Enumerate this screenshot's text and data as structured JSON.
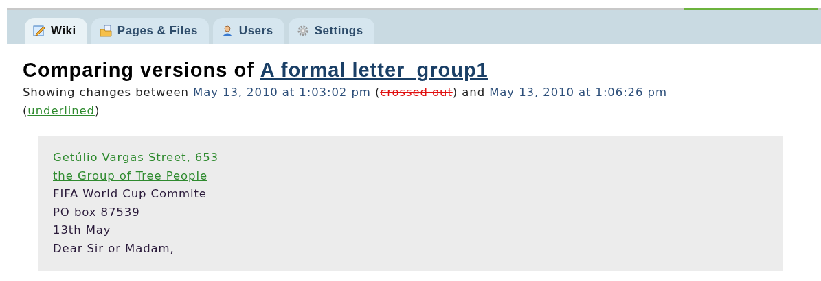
{
  "tabs": [
    {
      "label": "Wiki",
      "kind": "edit",
      "selected": true
    },
    {
      "label": "Pages & Files",
      "kind": "folder",
      "selected": false
    },
    {
      "label": "Users",
      "kind": "user",
      "selected": false
    },
    {
      "label": "Settings",
      "kind": "gear",
      "selected": false
    }
  ],
  "heading": {
    "prefix": "Comparing versions of",
    "link": "A formal letter_group1"
  },
  "summary": [
    {
      "kind": "text",
      "text": "Showing changes between "
    },
    {
      "kind": "link",
      "text": "May 13, 2010 at 1:03:02 pm"
    },
    {
      "kind": "text",
      "text": " ("
    },
    {
      "kind": "deleted",
      "text": "crossed out"
    },
    {
      "kind": "text",
      "text": ") and "
    },
    {
      "kind": "link",
      "text": "May 13, 2010 at 1:06:26 pm"
    },
    {
      "kind": "text",
      "text": " ("
    },
    {
      "kind": "inserted",
      "text": "underlined"
    },
    {
      "kind": "text",
      "text": ")"
    }
  ],
  "diff_lines": [
    {
      "kind": "inserted",
      "text": "Getúlio Vargas Street, 653"
    },
    {
      "kind": "inserted",
      "text": "the Group of Tree People"
    },
    {
      "kind": "unchanged",
      "text": "FIFA World Cup Commite"
    },
    {
      "kind": "unchanged",
      "text": "PO box 87539"
    },
    {
      "kind": "unchanged",
      "text": "13th May"
    },
    {
      "kind": "unchanged",
      "text": "Dear Sir or Madam,"
    }
  ]
}
